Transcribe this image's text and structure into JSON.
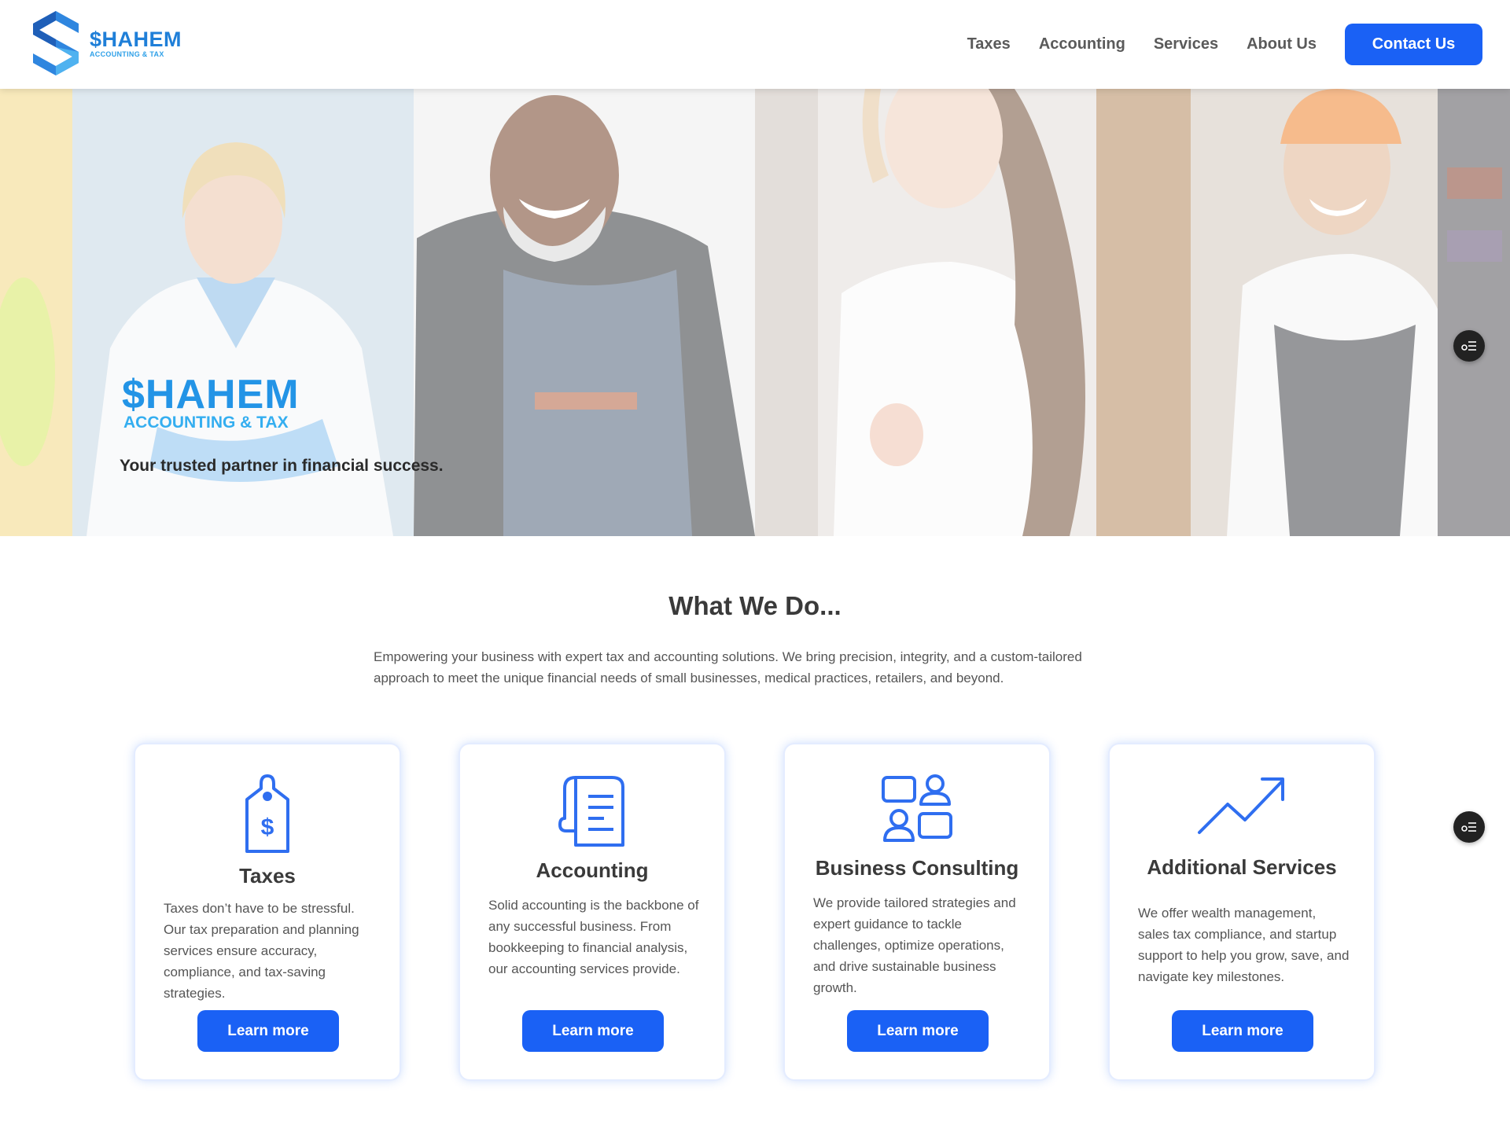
{
  "header": {
    "logo_name": "$HAHEM",
    "logo_sub": "ACCOUNTING & TAX",
    "nav": [
      "Taxes",
      "Accounting",
      "Services",
      "About Us"
    ],
    "contact_label": "Contact Us"
  },
  "hero": {
    "brand_name": "$HAHEM",
    "brand_sub": "ACCOUNTING & TAX",
    "tagline": "Your trusted partner in financial success."
  },
  "section": {
    "title": "What We Do...",
    "description": "Empowering your business with expert tax and accounting solutions. We bring precision, integrity, and a custom-tailored approach to meet the unique financial needs of small businesses, medical practices, retailers, and beyond."
  },
  "cards": [
    {
      "title": "Taxes",
      "icon": "price-tag-dollar-icon",
      "text": "Taxes don’t have to be stressful. Our tax preparation and planning services ensure accuracy, compliance, and tax-saving strategies.",
      "button": "Learn more"
    },
    {
      "title": "Accounting",
      "icon": "ledger-document-icon",
      "text": "Solid accounting is the backbone of any successful business. From bookkeeping to financial analysis, our accounting services provide.",
      "button": "Learn more"
    },
    {
      "title": "Business Consulting",
      "icon": "consulting-people-icon",
      "text": "We provide tailored strategies and expert guidance to tackle challenges, optimize operations, and drive sustainable business growth.",
      "button": "Learn more"
    },
    {
      "title": "Additional Services",
      "icon": "trending-up-icon",
      "text": "We offer wealth management, sales tax compliance, and startup support to help you grow, save, and navigate key milestones.",
      "button": "Learn more"
    }
  ],
  "colors": {
    "primary_button": "#1a61f5",
    "icon_blue": "#2f6ef0",
    "brand_blue": "#2394e6"
  }
}
